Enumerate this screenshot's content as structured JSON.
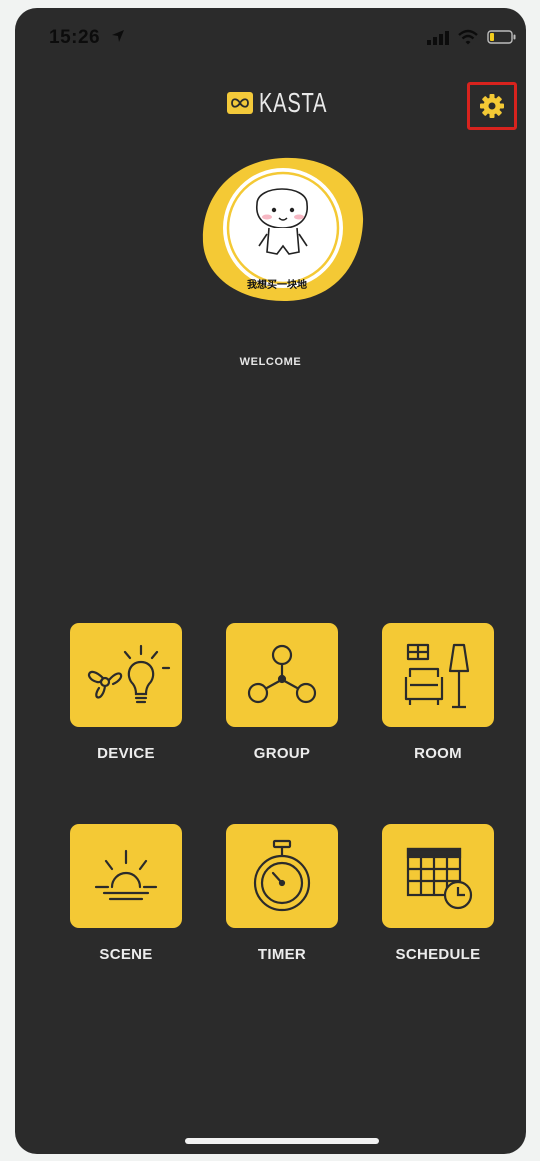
{
  "status_bar": {
    "time": "15:26"
  },
  "header": {
    "brand": "KASTA"
  },
  "profile": {
    "avatar_caption": "我想买一块地",
    "welcome": "WELCOME"
  },
  "tiles": [
    {
      "label": "DEVICE",
      "icon": "fan-bulb-icon"
    },
    {
      "label": "GROUP",
      "icon": "group-nodes-icon"
    },
    {
      "label": "ROOM",
      "icon": "room-sofa-lamp-icon"
    },
    {
      "label": "SCENE",
      "icon": "sunrise-icon"
    },
    {
      "label": "TIMER",
      "icon": "stopwatch-icon"
    },
    {
      "label": "SCHEDULE",
      "icon": "calendar-clock-icon"
    }
  ],
  "colors": {
    "accent": "#F4C935",
    "background": "#2B2B2B",
    "highlight": "#D8231E"
  }
}
